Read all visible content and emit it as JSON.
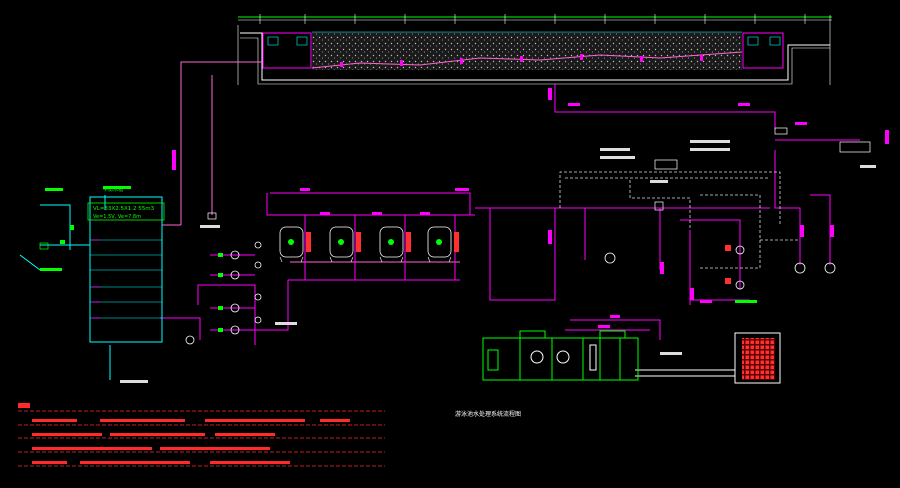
{
  "drawing": {
    "tank_spec_line1": "VL=33X2.5X1.2 55m3",
    "tank_spec_line2": "Ve=1.5V, Ve=7.8m",
    "tank_title": "平衡水箱",
    "title": "游泳池水处理系统流程图"
  },
  "colors": {
    "background": "#000000",
    "pipe_magenta": "#ff00ff",
    "pipe_pink": "#ff66cc",
    "outline_white": "#ffffff",
    "equipment_green": "#00ff00",
    "note_red": "#ff2a2a",
    "dashed_white": "#dddddd",
    "tank_cyan": "#00ffff",
    "heater_red": "#ff3030"
  },
  "icons": [
    "pool-basin-icon",
    "balance-tank-icon",
    "pump-icon",
    "sand-filter-icon",
    "heat-exchanger-icon",
    "air-heat-pump-icon",
    "valve-icon"
  ]
}
